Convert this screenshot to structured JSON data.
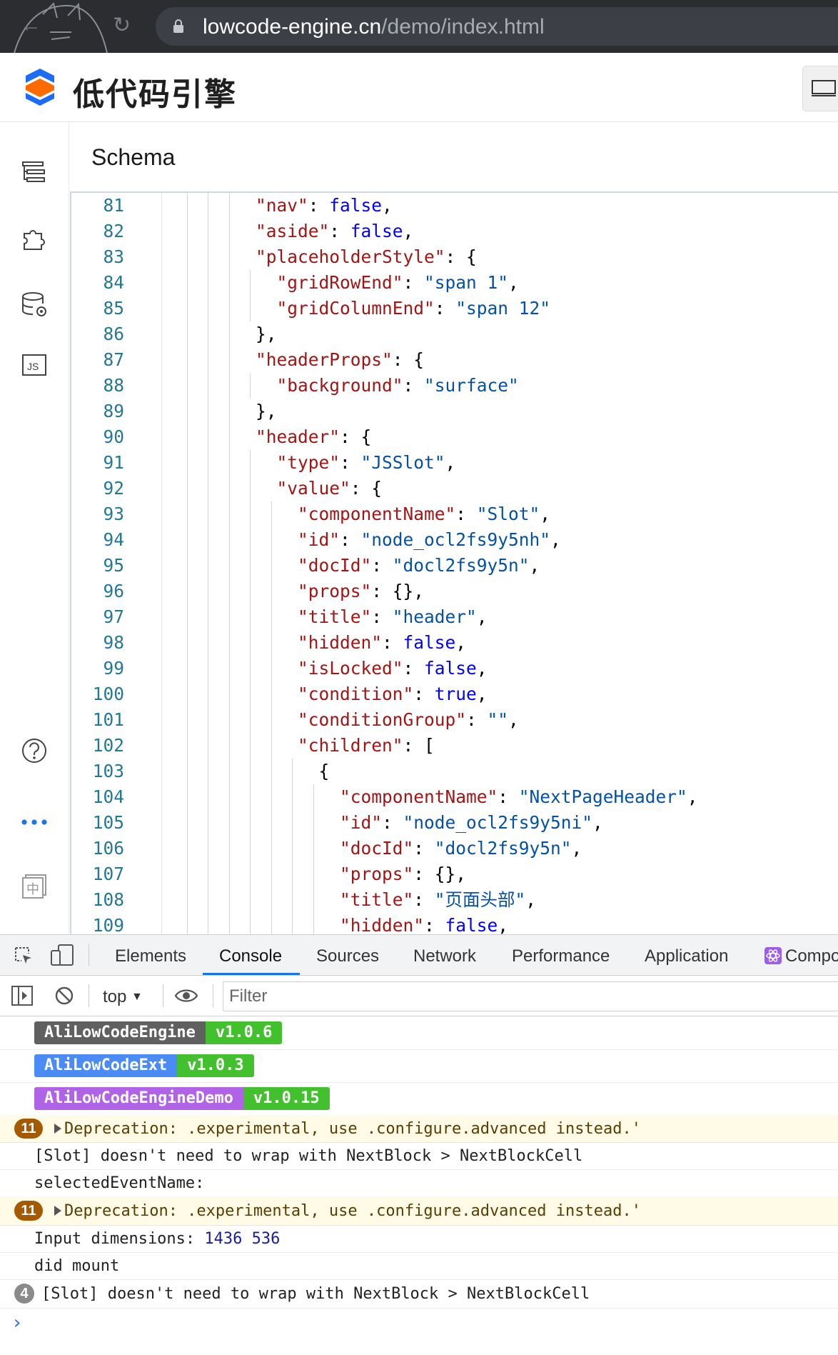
{
  "browser": {
    "url_host": "lowcode-engine.cn",
    "url_path": "/demo/index.html"
  },
  "app": {
    "name": "低代码引擎"
  },
  "panel": {
    "title": "Schema"
  },
  "editor": {
    "lines": [
      {
        "n": "81",
        "indent": 8,
        "tokens": [
          [
            "k",
            "\"nav\""
          ],
          [
            "p",
            ": "
          ],
          [
            "b",
            "false"
          ],
          [
            "p",
            ","
          ]
        ]
      },
      {
        "n": "82",
        "indent": 8,
        "tokens": [
          [
            "k",
            "\"aside\""
          ],
          [
            "p",
            ": "
          ],
          [
            "b",
            "false"
          ],
          [
            "p",
            ","
          ]
        ]
      },
      {
        "n": "83",
        "indent": 8,
        "tokens": [
          [
            "k",
            "\"placeholderStyle\""
          ],
          [
            "p",
            ": {"
          ]
        ]
      },
      {
        "n": "84",
        "indent": 10,
        "tokens": [
          [
            "k",
            "\"gridRowEnd\""
          ],
          [
            "p",
            ": "
          ],
          [
            "s",
            "\"span 1\""
          ],
          [
            "p",
            ","
          ]
        ]
      },
      {
        "n": "85",
        "indent": 10,
        "tokens": [
          [
            "k",
            "\"gridColumnEnd\""
          ],
          [
            "p",
            ": "
          ],
          [
            "s",
            "\"span 12\""
          ]
        ]
      },
      {
        "n": "86",
        "indent": 8,
        "tokens": [
          [
            "p",
            "},"
          ]
        ]
      },
      {
        "n": "87",
        "indent": 8,
        "tokens": [
          [
            "k",
            "\"headerProps\""
          ],
          [
            "p",
            ": {"
          ]
        ]
      },
      {
        "n": "88",
        "indent": 10,
        "tokens": [
          [
            "k",
            "\"background\""
          ],
          [
            "p",
            ": "
          ],
          [
            "s",
            "\"surface\""
          ]
        ]
      },
      {
        "n": "89",
        "indent": 8,
        "tokens": [
          [
            "p",
            "},"
          ]
        ]
      },
      {
        "n": "90",
        "indent": 8,
        "tokens": [
          [
            "k",
            "\"header\""
          ],
          [
            "p",
            ": {"
          ]
        ]
      },
      {
        "n": "91",
        "indent": 10,
        "tokens": [
          [
            "k",
            "\"type\""
          ],
          [
            "p",
            ": "
          ],
          [
            "s",
            "\"JSSlot\""
          ],
          [
            "p",
            ","
          ]
        ]
      },
      {
        "n": "92",
        "indent": 10,
        "tokens": [
          [
            "k",
            "\"value\""
          ],
          [
            "p",
            ": {"
          ]
        ]
      },
      {
        "n": "93",
        "indent": 12,
        "tokens": [
          [
            "k",
            "\"componentName\""
          ],
          [
            "p",
            ": "
          ],
          [
            "s",
            "\"Slot\""
          ],
          [
            "p",
            ","
          ]
        ]
      },
      {
        "n": "94",
        "indent": 12,
        "tokens": [
          [
            "k",
            "\"id\""
          ],
          [
            "p",
            ": "
          ],
          [
            "s",
            "\"node_ocl2fs9y5nh\""
          ],
          [
            "p",
            ","
          ]
        ]
      },
      {
        "n": "95",
        "indent": 12,
        "tokens": [
          [
            "k",
            "\"docId\""
          ],
          [
            "p",
            ": "
          ],
          [
            "s",
            "\"docl2fs9y5n\""
          ],
          [
            "p",
            ","
          ]
        ]
      },
      {
        "n": "96",
        "indent": 12,
        "tokens": [
          [
            "k",
            "\"props\""
          ],
          [
            "p",
            ": {},"
          ]
        ]
      },
      {
        "n": "97",
        "indent": 12,
        "tokens": [
          [
            "k",
            "\"title\""
          ],
          [
            "p",
            ": "
          ],
          [
            "s",
            "\"header\""
          ],
          [
            "p",
            ","
          ]
        ]
      },
      {
        "n": "98",
        "indent": 12,
        "tokens": [
          [
            "k",
            "\"hidden\""
          ],
          [
            "p",
            ": "
          ],
          [
            "b",
            "false"
          ],
          [
            "p",
            ","
          ]
        ]
      },
      {
        "n": "99",
        "indent": 12,
        "tokens": [
          [
            "k",
            "\"isLocked\""
          ],
          [
            "p",
            ": "
          ],
          [
            "b",
            "false"
          ],
          [
            "p",
            ","
          ]
        ]
      },
      {
        "n": "100",
        "indent": 12,
        "tokens": [
          [
            "k",
            "\"condition\""
          ],
          [
            "p",
            ": "
          ],
          [
            "b",
            "true"
          ],
          [
            "p",
            ","
          ]
        ]
      },
      {
        "n": "101",
        "indent": 12,
        "tokens": [
          [
            "k",
            "\"conditionGroup\""
          ],
          [
            "p",
            ": "
          ],
          [
            "s",
            "\"\""
          ],
          [
            "p",
            ","
          ]
        ]
      },
      {
        "n": "102",
        "indent": 12,
        "tokens": [
          [
            "k",
            "\"children\""
          ],
          [
            "p",
            ": ["
          ]
        ]
      },
      {
        "n": "103",
        "indent": 14,
        "tokens": [
          [
            "p",
            "{"
          ]
        ]
      },
      {
        "n": "104",
        "indent": 16,
        "tokens": [
          [
            "k",
            "\"componentName\""
          ],
          [
            "p",
            ": "
          ],
          [
            "s",
            "\"NextPageHeader\""
          ],
          [
            "p",
            ","
          ]
        ]
      },
      {
        "n": "105",
        "indent": 16,
        "tokens": [
          [
            "k",
            "\"id\""
          ],
          [
            "p",
            ": "
          ],
          [
            "s",
            "\"node_ocl2fs9y5ni\""
          ],
          [
            "p",
            ","
          ]
        ]
      },
      {
        "n": "106",
        "indent": 16,
        "tokens": [
          [
            "k",
            "\"docId\""
          ],
          [
            "p",
            ": "
          ],
          [
            "s",
            "\"docl2fs9y5n\""
          ],
          [
            "p",
            ","
          ]
        ]
      },
      {
        "n": "107",
        "indent": 16,
        "tokens": [
          [
            "k",
            "\"props\""
          ],
          [
            "p",
            ": {},"
          ]
        ]
      },
      {
        "n": "108",
        "indent": 16,
        "tokens": [
          [
            "k",
            "\"title\""
          ],
          [
            "p",
            ": "
          ],
          [
            "s",
            "\"页面头部\""
          ],
          [
            "p",
            ","
          ]
        ]
      },
      {
        "n": "109",
        "indent": 16,
        "tokens": [
          [
            "k",
            "\"hidden\""
          ],
          [
            "p",
            ": "
          ],
          [
            "b",
            "false"
          ],
          [
            "p",
            ","
          ]
        ]
      }
    ]
  },
  "devtools": {
    "tabs": [
      "Elements",
      "Console",
      "Sources",
      "Network",
      "Performance",
      "Application",
      "Compo"
    ],
    "active_tab": "Console",
    "context": "top",
    "filter_placeholder": "Filter",
    "badges": [
      {
        "name": "AliLowCodeEngine",
        "version": "v1.0.6",
        "color": "#606060"
      },
      {
        "name": "AliLowCodeExt",
        "version": "v1.0.3",
        "color": "#4a8bf5"
      },
      {
        "name": "AliLowCodeEngineDemo",
        "version": "v1.0.15",
        "color": "#b163e8"
      }
    ],
    "messages": {
      "warn1_count": "11",
      "warn1_text": "Deprecation: .experimental, use .configure.advanced instead.'",
      "slot_text": "[Slot] doesn't need to wrap with NextBlock > NextBlockCell",
      "selected_text": "selectedEventName:",
      "warn2_count": "11",
      "warn2_text": "Deprecation: .experimental, use .configure.advanced instead.'",
      "dims_label": "Input dimensions: ",
      "dims_w": "1436",
      "dims_h": "536",
      "mount_text": "did mount",
      "slot2_count": "4",
      "slot2_text": "[Slot] doesn't need to wrap with NextBlock > NextBlockCell",
      "prompt": "›"
    }
  }
}
